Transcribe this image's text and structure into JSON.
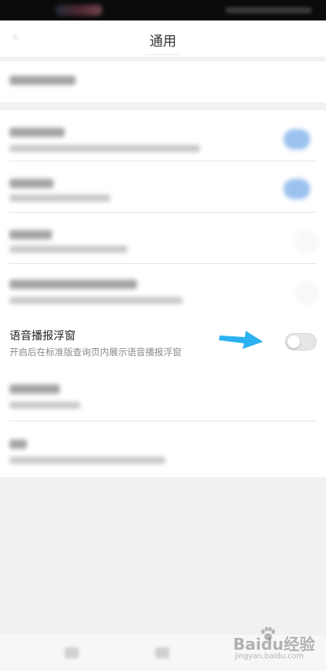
{
  "header": {
    "title": "通用"
  },
  "settings": {
    "voice_float": {
      "title": "语音播报浮窗",
      "subtitle": "开启后在标准版查询页内展示语音播报浮窗",
      "enabled": false
    }
  },
  "watermark": {
    "brand": "Baidu经验",
    "site": "jingyan.baidu.com"
  },
  "colors": {
    "accent_blue": "#4a90e2",
    "arrow_blue": "#2bb1f0",
    "toggle_off": "#e6e6e6"
  },
  "icons": {
    "back": "back-arrow-icon",
    "annotation": "arrow-pointer-icon"
  }
}
